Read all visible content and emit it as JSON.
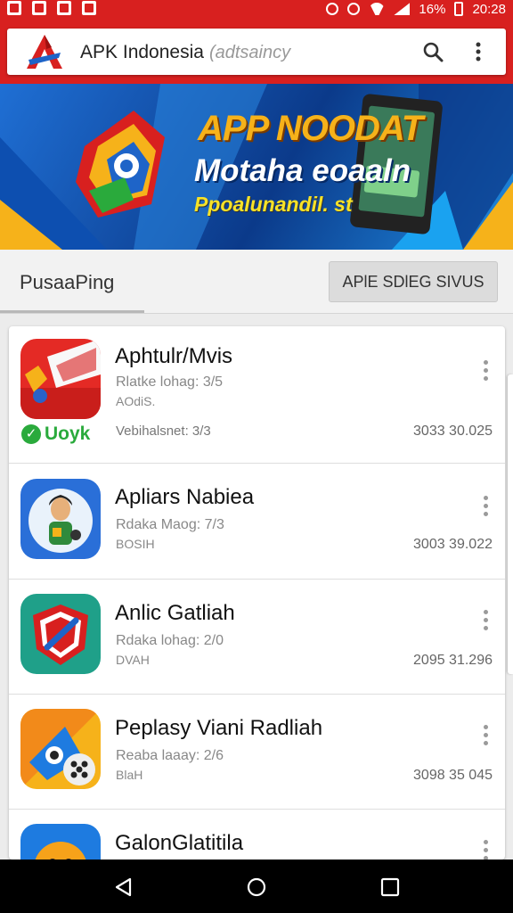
{
  "status_bar": {
    "battery": "16%",
    "time": "20:28"
  },
  "header": {
    "title": "APK Indonesia",
    "subtitle": "(adtsaincy"
  },
  "banner": {
    "title": "APP NOODAT",
    "line2": "Motaha eoaaln",
    "line3": "Ppoalunandil. st"
  },
  "tabs": {
    "active_label": "PusaaPing",
    "button_label": "APlE SDlEG SIVUS"
  },
  "apps": [
    {
      "name": "Aphtulr/Mvis",
      "rating": "Rlatke lohag: 3/5",
      "sub": "AOdiS.",
      "date": "Vebihalsnet: 3/3",
      "size": "3033 30.025",
      "badge": "Uoyk"
    },
    {
      "name": "Apliars Nabiea",
      "rating": "Rdaka Maog: 7/3",
      "sub": "BOSIH",
      "size": "3003 39.022"
    },
    {
      "name": "Anlic Gatliah",
      "rating": "Rdaka lohag: 2/0",
      "sub": "DVAH",
      "size": "2095 31.296"
    },
    {
      "name": "Peplasy Viani Radliah",
      "rating": "Reaba laaay: 2/6",
      "sub": "BlaH",
      "size": "3098 35 045"
    },
    {
      "name": "GalonGlatitila"
    }
  ],
  "colors": {
    "accent": "#d8201f",
    "badge_green": "#2aaa3c"
  }
}
